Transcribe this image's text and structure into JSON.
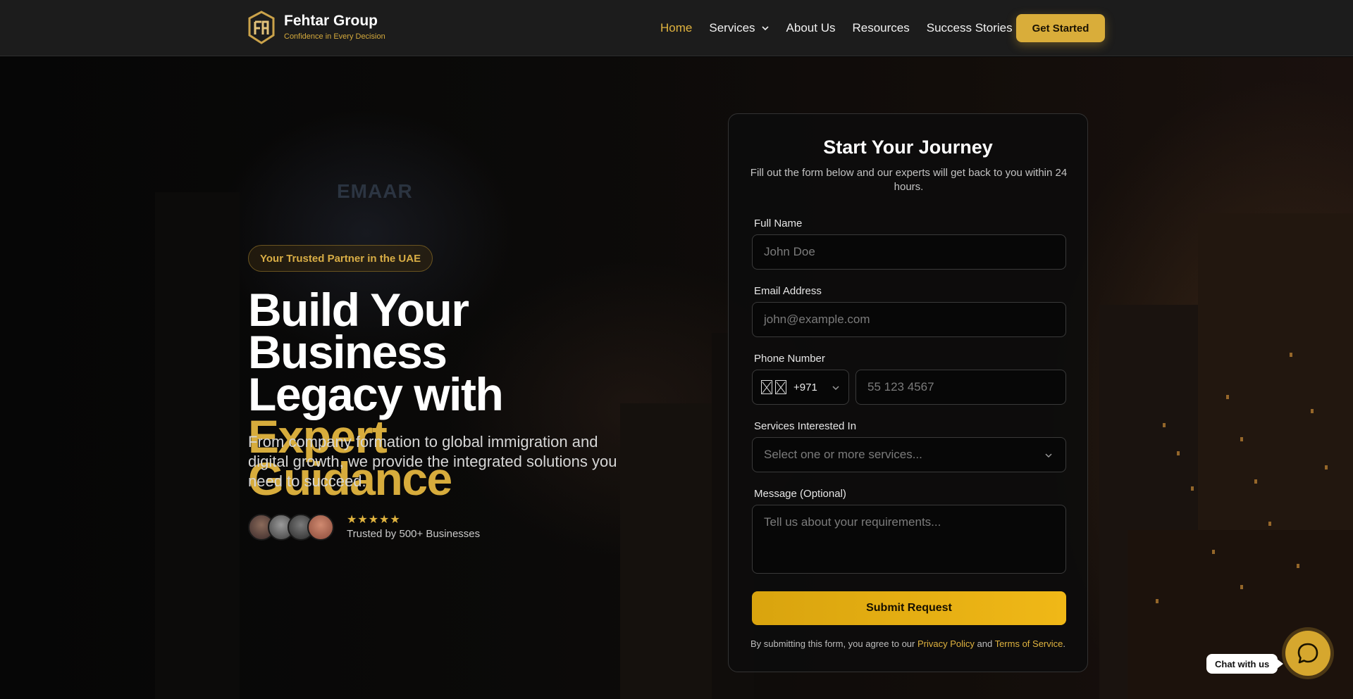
{
  "brand": {
    "name": "Fehtar Group",
    "tagline": "Confidence in Every Decision",
    "accent": "#d9ad3a"
  },
  "nav": {
    "items": [
      {
        "label": "Home",
        "active": true
      },
      {
        "label": "Services",
        "dropdown": true
      },
      {
        "label": "About Us"
      },
      {
        "label": "Resources"
      },
      {
        "label": "Success Stories"
      }
    ],
    "cta_label": "Get Started"
  },
  "hero": {
    "badge": "Your Trusted Partner in the UAE",
    "headline_line1": "Build Your Business",
    "headline_line2_white": "Legacy with ",
    "headline_line2_gold": "Expert",
    "headline_line3_gold": "Guidance",
    "subtext": "From company formation to global immigration and digital growth, we provide the integrated solutions you need to succeed.",
    "stars": "★★★★★",
    "trust_text": "Trusted by 500+ Businesses",
    "background_sign": "EMAAR"
  },
  "form": {
    "title": "Start Your Journey",
    "subtitle": "Fill out the form below and our experts will get back to you within 24 hours.",
    "full_name": {
      "label": "Full Name",
      "placeholder": "John Doe"
    },
    "email": {
      "label": "Email Address",
      "placeholder": "john@example.com"
    },
    "phone": {
      "label": "Phone Number",
      "code": "+971",
      "placeholder": "55 123 4567"
    },
    "services": {
      "label": "Services Interested In",
      "placeholder": "Select one or more services..."
    },
    "message": {
      "label": "Message (Optional)",
      "placeholder": "Tell us about your requirements..."
    },
    "submit_label": "Submit Request",
    "disclaimer_prefix": "By submitting this form, you agree to our ",
    "privacy_label": "Privacy Policy",
    "disclaimer_and": " and ",
    "terms_label": "Terms of Service",
    "disclaimer_suffix": "."
  },
  "chat": {
    "label": "Chat with us"
  }
}
